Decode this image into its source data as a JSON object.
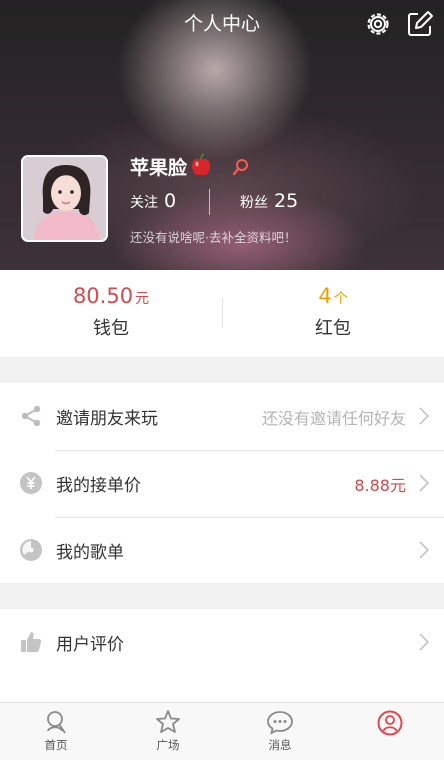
{
  "header": {
    "title": "个人中心"
  },
  "profile": {
    "name": "苹果脸",
    "follow_label": "关注",
    "follow_count": "0",
    "fans_label": "粉丝",
    "fans_count": "25",
    "tagline": "还没有说啥呢·去补全资料吧！"
  },
  "money": {
    "wallet_amount": "80.50",
    "wallet_unit": "元",
    "wallet_label": "钱包",
    "packet_amount": "4",
    "packet_unit": "个",
    "packet_label": "红包"
  },
  "menu": [
    {
      "label": "邀请朋友来玩",
      "value": "还没有邀请任何好友",
      "icon": "share-icon"
    },
    {
      "label": "我的接单价",
      "value": "8.88元",
      "icon": "yuan-icon"
    },
    {
      "label": "我的歌单",
      "value": "",
      "icon": "music-disc-icon"
    }
  ],
  "menu2": [
    {
      "label": "用户评价",
      "icon": "thumbs-up-icon"
    }
  ],
  "tabs": [
    {
      "label": "首页",
      "icon": "home-icon"
    },
    {
      "label": "广场",
      "icon": "star-icon"
    },
    {
      "label": "消息",
      "icon": "chat-icon"
    }
  ],
  "colors": {
    "accent_red": "#d14a4e",
    "accent_gold": "#e8a200"
  }
}
